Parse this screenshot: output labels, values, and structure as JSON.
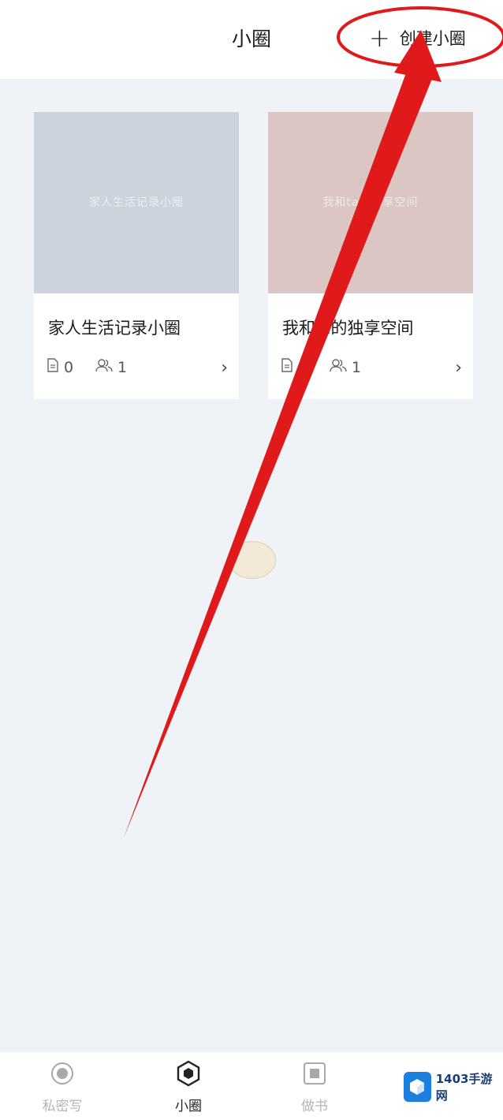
{
  "header": {
    "title": "小圈",
    "create_plus": "+",
    "create_label": "创建小圈"
  },
  "circles": [
    {
      "cover_text": "家人生活记录小圈",
      "cover_color": "#ccd3dd",
      "name": "家人生活记录小圈",
      "posts": "0",
      "members": "1",
      "chevron": "›"
    },
    {
      "cover_text": "我和ta的独享空间",
      "cover_color": "#dcc6c4",
      "name": "我和  a的独享空间",
      "members": "1",
      "chevron": "›"
    }
  ],
  "tabs": [
    {
      "label": "私密写",
      "icon": "record-icon",
      "active": false
    },
    {
      "label": "小圈",
      "icon": "hexagon-icon",
      "active": true
    },
    {
      "label": "做书",
      "icon": "book-icon",
      "active": false
    }
  ],
  "watermark": {
    "text": "1403手游网"
  },
  "colors": {
    "annotation_red": "#e01a1a",
    "accent_blue": "#1d7fe0"
  }
}
